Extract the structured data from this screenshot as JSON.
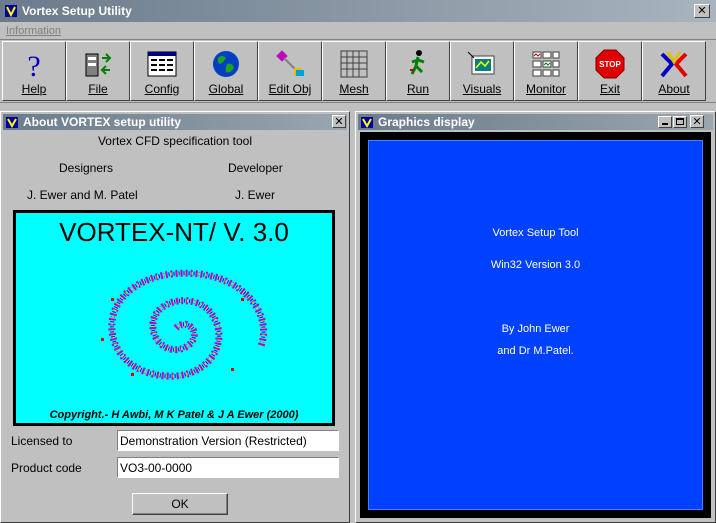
{
  "app": {
    "title": "Vortex Setup Utility"
  },
  "menu": {
    "items": [
      "Information"
    ]
  },
  "toolbar": {
    "buttons": [
      {
        "label": "Help",
        "icon": "help-icon"
      },
      {
        "label": "File",
        "icon": "file-icon"
      },
      {
        "label": "Config",
        "icon": "config-icon"
      },
      {
        "label": "Global",
        "icon": "globe-icon"
      },
      {
        "label": "Edit Obj",
        "icon": "edit-object-icon"
      },
      {
        "label": "Mesh",
        "icon": "mesh-grid-icon"
      },
      {
        "label": "Run",
        "icon": "runner-icon"
      },
      {
        "label": "Visuals",
        "icon": "visuals-icon"
      },
      {
        "label": "Monitor",
        "icon": "monitor-icon"
      },
      {
        "label": "Exit",
        "icon": "stop-sign-icon"
      },
      {
        "label": "About",
        "icon": "about-logo-icon"
      }
    ],
    "stop_text": "STOP"
  },
  "about": {
    "title": "About VORTEX setup utility",
    "subtitle": "Vortex CFD specification tool",
    "designers_heading": "Designers",
    "developer_heading": "Developer",
    "designers": "J. Ewer  and  M. Patel",
    "developer": "J. Ewer",
    "logo_title": "VORTEX-NT/ V. 3.0",
    "logo_copyright": "Copyright.- H Awbi, M K Patel & J A Ewer (2000)",
    "licensed_label": "Licensed to",
    "licensed_value": "Demonstration Version (Restricted)",
    "product_label": "Product code",
    "product_value": "VO3-00-0000",
    "ok_label": "OK"
  },
  "graphics": {
    "title": "Graphics display",
    "line1": "Vortex Setup Tool",
    "line2": "Win32 Version 3.0",
    "line3": "By  John Ewer",
    "line4": "and Dr M.Patel."
  },
  "colors": {
    "graphics_bg": "#0040ff",
    "logo_bg": "#00ffff",
    "title_bar": "#6b7b8b"
  }
}
